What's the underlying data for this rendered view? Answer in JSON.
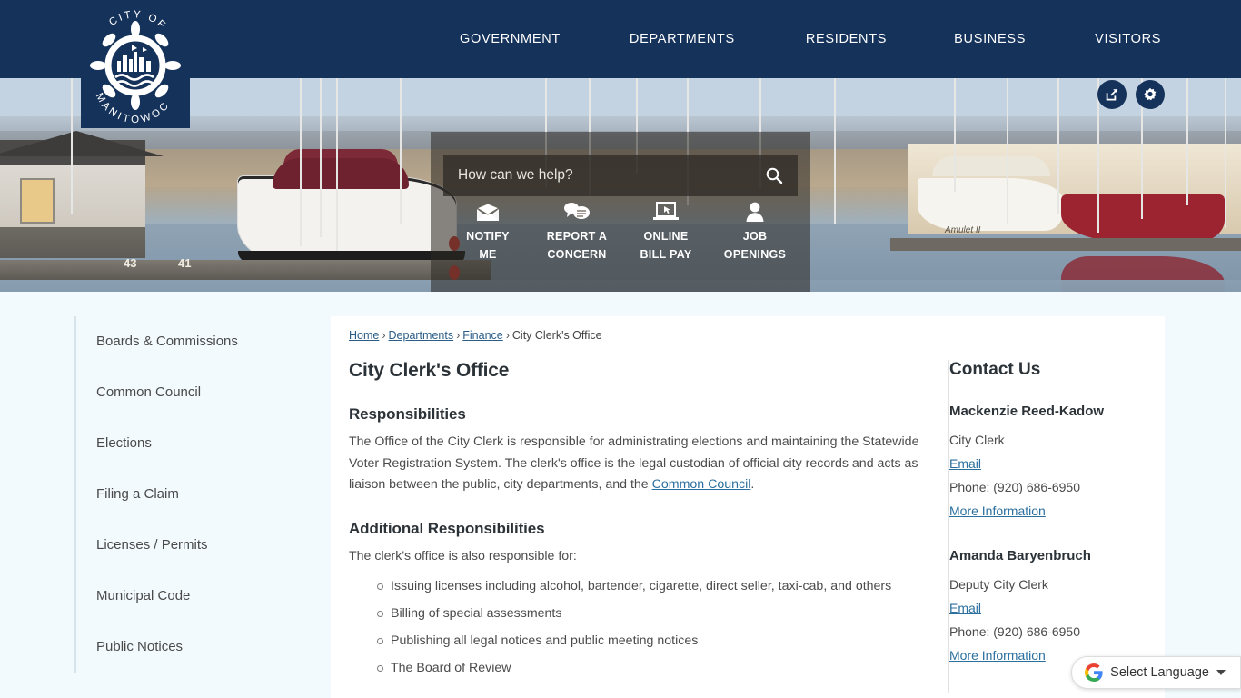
{
  "site": {
    "logo_line1": "CITY OF",
    "logo_line2": "MANITOWOC"
  },
  "nav": {
    "items": [
      {
        "label": "GOVERNMENT"
      },
      {
        "label": "DEPARTMENTS"
      },
      {
        "label": "RESIDENTS"
      },
      {
        "label": "BUSINESS"
      },
      {
        "label": "VISITORS"
      }
    ]
  },
  "header_buttons": [
    {
      "name": "share-icon",
      "label": "Share"
    },
    {
      "name": "gear-icon",
      "label": "Site Tools"
    }
  ],
  "search": {
    "placeholder": "How can we help?",
    "value": "",
    "button_label": "Search"
  },
  "quicklinks": [
    {
      "icon": "envelope-icon",
      "line1": "NOTIFY",
      "line2": "ME"
    },
    {
      "icon": "speech-bubbles-icon",
      "line1": "REPORT A",
      "line2": "CONCERN"
    },
    {
      "icon": "laptop-cursor-icon",
      "line1": "ONLINE",
      "line2": "BILL PAY"
    },
    {
      "icon": "person-icon",
      "line1": "JOB",
      "line2": "OPENINGS"
    }
  ],
  "sidebar": {
    "items": [
      {
        "label": "Boards & Commissions"
      },
      {
        "label": "Common Council"
      },
      {
        "label": "Elections"
      },
      {
        "label": "Filing a Claim"
      },
      {
        "label": "Licenses / Permits"
      },
      {
        "label": "Municipal Code"
      },
      {
        "label": "Public Notices"
      }
    ]
  },
  "breadcrumb": {
    "items": [
      {
        "label": "Home",
        "link": true
      },
      {
        "label": "Departments",
        "link": true
      },
      {
        "label": "Finance",
        "link": true
      },
      {
        "label": "City Clerk's Office",
        "link": false
      }
    ],
    "separator": "›"
  },
  "main": {
    "title": "City Clerk's Office",
    "sections": [
      {
        "heading": "Responsibilities",
        "paragraph_before_link": "The Office of the City Clerk is responsible for administrating elections and maintaining the Statewide Voter Registration System. The clerk's office is the legal custodian of official city records and acts as liaison between the public, city departments, and the ",
        "link_text": "Common Council",
        "paragraph_after_link": "."
      },
      {
        "heading": "Additional Responsibilities",
        "intro": "The clerk's office is also responsible for:",
        "bullets": [
          "Issuing licenses including alcohol, bartender, cigarette, direct seller, taxi-cab, and others",
          "Billing of special assessments",
          "Publishing all legal notices and public meeting notices",
          "The Board of Review"
        ]
      }
    ]
  },
  "contact": {
    "heading": "Contact Us",
    "people": [
      {
        "name": "Mackenzie Reed-Kadow",
        "title": "City Clerk",
        "email_label": "Email",
        "phone": "Phone: (920) 686-6950",
        "more_label": "More Information"
      },
      {
        "name": "Amanda Baryenbruch",
        "title": "Deputy City Clerk",
        "email_label": "Email",
        "phone": "Phone: (920) 686-6950",
        "more_label": "More Information"
      }
    ]
  },
  "translate": {
    "label": "Select Language",
    "icon": "google-g-icon"
  },
  "colors": {
    "nav_blue": "#15325b",
    "page_bg": "#f2fafd",
    "link": "#2b6f9e",
    "text": "#4b4b4b"
  }
}
